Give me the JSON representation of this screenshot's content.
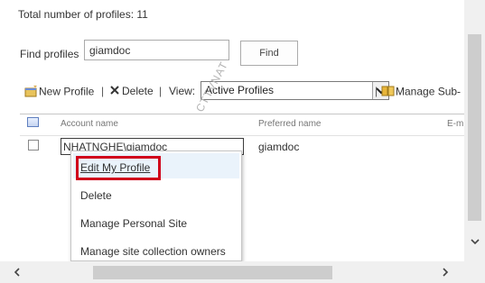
{
  "summary": {
    "total_text": "Total number of profiles: 11"
  },
  "search": {
    "label": "Find profiles",
    "value": "giamdoc",
    "button": "Find"
  },
  "toolbar": {
    "new_profile": "New Profile",
    "delete": "Delete",
    "view_label": "View:",
    "view_selected": "Active Profiles",
    "manage_sub": "Manage Sub-"
  },
  "grid": {
    "headers": {
      "account": "Account name",
      "preferred": "Preferred name",
      "email": "E-m"
    },
    "rows": [
      {
        "account": "NHATNGHE\\giamdoc",
        "preferred": "giamdoc"
      }
    ]
  },
  "context_menu": {
    "items": [
      "Edit My Profile",
      "Delete",
      "Manage Personal Site",
      "Manage site collection owners"
    ]
  },
  "watermark": "CTTVNAT",
  "colors": {
    "highlight_box": "#d0021b",
    "menu_hover": "#eaf3fb"
  }
}
